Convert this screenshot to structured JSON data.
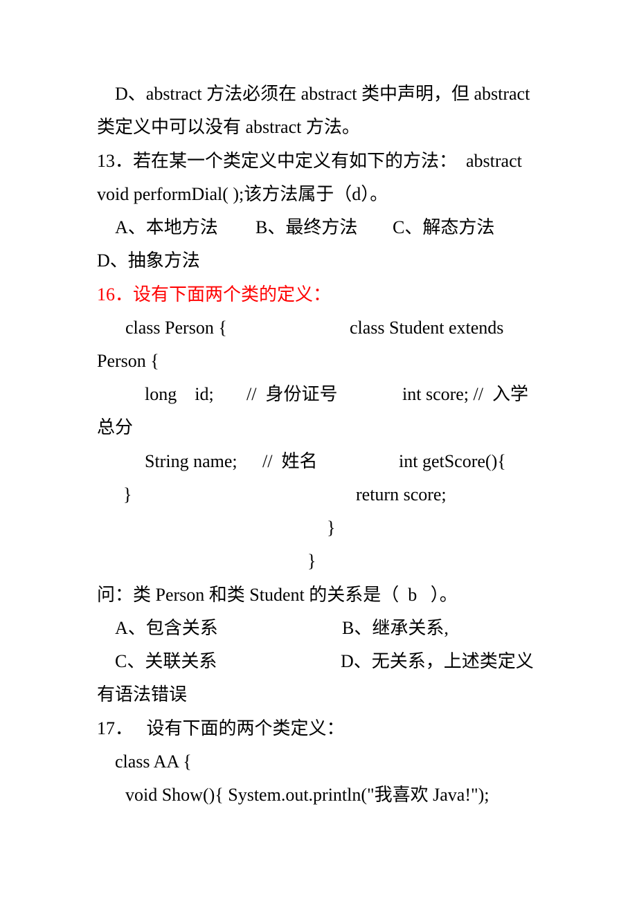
{
  "document": {
    "accent_color": "#ff0000",
    "lines": [
      {
        "text": "D、abstract 方法必须在 abstract 类中声明，但 abstract"
      },
      {
        "text": "类定义中可以没有 abstract 方法。"
      },
      {
        "text": "13．若在某一个类定义中定义有如下的方法：  abstract"
      },
      {
        "text": "void performDial( );该方法属于（d）。"
      },
      {
        "text": "A、本地方法"
      },
      {
        "text": "B、最终方法"
      },
      {
        "text": "C、解态方法"
      },
      {
        "text": "D、抽象方法"
      },
      {
        "text": "16．设有下面两个类的定义："
      },
      {
        "text": "class Person {"
      },
      {
        "text": "class Student extends"
      },
      {
        "text": "Person {"
      },
      {
        "text": "long    id;"
      },
      {
        "text": "//  身份证号"
      },
      {
        "text": "int score; //  入学"
      },
      {
        "text": "总分"
      },
      {
        "text": "String name;"
      },
      {
        "text": "//  姓名"
      },
      {
        "text": "int getScore(){"
      },
      {
        "text": "}"
      },
      {
        "text": "return score;"
      },
      {
        "text": "}"
      },
      {
        "text": "}"
      },
      {
        "text": "问：类 Person 和类 Student 的关系是（  b   ）。"
      },
      {
        "text": "A、包含关系"
      },
      {
        "text": "B、继承关系,"
      },
      {
        "text": "C、关联关系"
      },
      {
        "text": "D、无关系，上述类定义"
      },
      {
        "text": "有语法错误"
      },
      {
        "text": "17．   设有下面的两个类定义："
      },
      {
        "text": "class AA {"
      },
      {
        "text": "void Show(){ System.out.println(\"我喜欢 Java!\");"
      }
    ]
  }
}
